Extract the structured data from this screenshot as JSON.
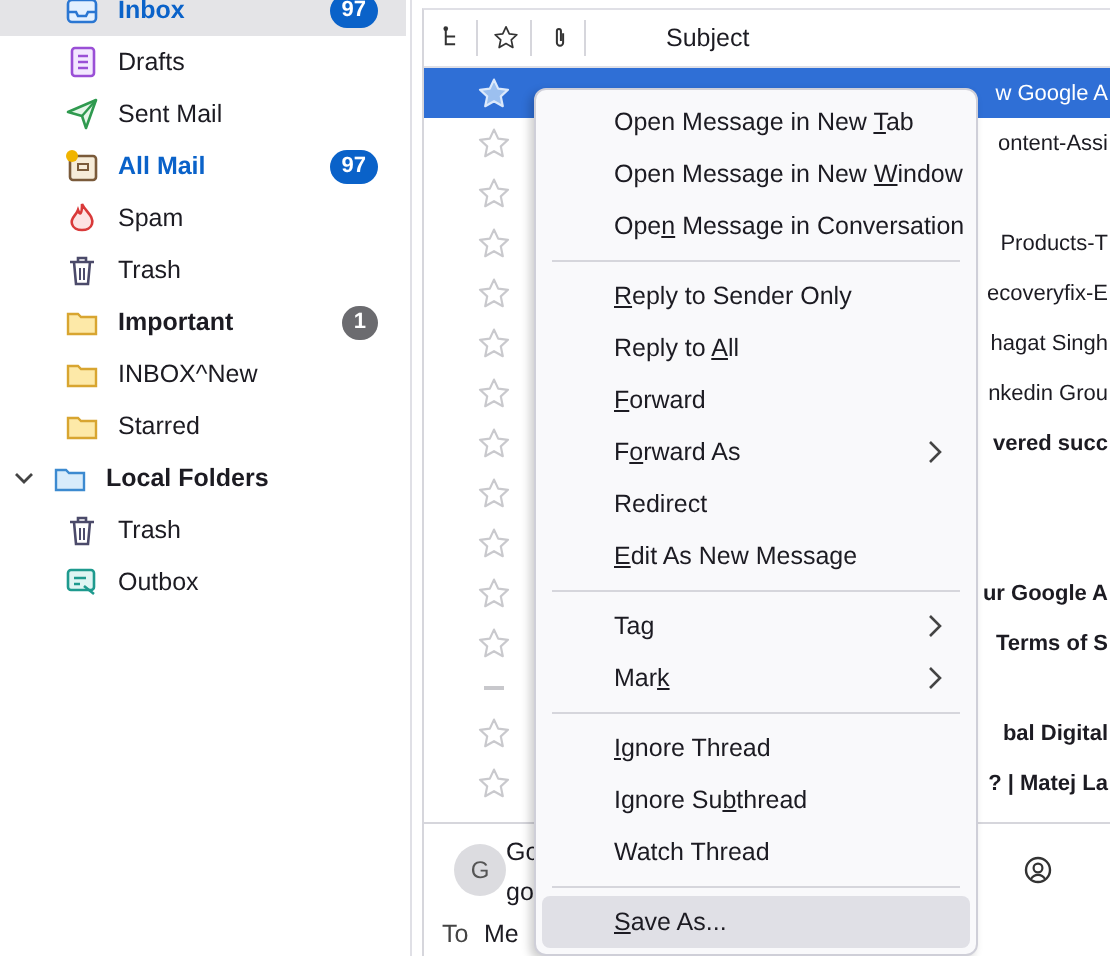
{
  "sidebar": {
    "folders": [
      {
        "kind": "inbox",
        "label": "Inbox",
        "selected": true,
        "bold": true,
        "count": "97",
        "count_highlighted": true
      },
      {
        "kind": "drafts",
        "label": "Drafts",
        "selected": false,
        "bold": false
      },
      {
        "kind": "sent",
        "label": "Sent Mail",
        "selected": false,
        "bold": false
      },
      {
        "kind": "archive",
        "label": "All Mail",
        "selected": false,
        "bold": true,
        "count": "97",
        "count_highlighted": true
      },
      {
        "kind": "spam",
        "label": "Spam",
        "selected": false,
        "bold": false
      },
      {
        "kind": "trash",
        "label": "Trash",
        "selected": false,
        "bold": false
      },
      {
        "kind": "folder",
        "label": "Important",
        "selected": false,
        "bold": true,
        "count": "1",
        "count_highlighted": false
      },
      {
        "kind": "folder",
        "label": "INBOX^New",
        "selected": false,
        "bold": false
      },
      {
        "kind": "folder",
        "label": "Starred",
        "selected": false,
        "bold": false
      },
      {
        "kind": "account",
        "label": "Local Folders",
        "selected": false,
        "bold": true,
        "expanded": true,
        "children": [
          {
            "kind": "trash",
            "label": "Trash",
            "selected": false,
            "bold": false
          },
          {
            "kind": "outbox",
            "label": "Outbox",
            "selected": false,
            "bold": false
          }
        ]
      }
    ]
  },
  "message_list": {
    "columns": [
      {
        "kind": "thread"
      },
      {
        "kind": "star"
      },
      {
        "kind": "attachment"
      },
      {
        "kind": "text",
        "label": "Subject"
      }
    ],
    "rows": [
      {
        "kind": "star",
        "subject": "w Google A",
        "selected": true,
        "bold": false
      },
      {
        "kind": "star",
        "subject": "ontent-Assi",
        "selected": false,
        "bold": false
      },
      {
        "kind": "star",
        "selected": false
      },
      {
        "kind": "star",
        "subject": "Products-T",
        "selected": false,
        "bold": false
      },
      {
        "kind": "star",
        "subject": "ecoveryfix-E",
        "selected": false,
        "bold": false
      },
      {
        "kind": "star",
        "subject": "hagat Singh",
        "selected": false,
        "bold": false
      },
      {
        "kind": "star",
        "subject": "nkedin Grou",
        "selected": false,
        "bold": false
      },
      {
        "kind": "star",
        "subject": "vered succ",
        "selected": false,
        "bold": true
      },
      {
        "kind": "star",
        "selected": false
      },
      {
        "kind": "star",
        "selected": false
      },
      {
        "kind": "star",
        "subject": "ur Google A",
        "selected": false,
        "bold": true
      },
      {
        "kind": "star",
        "subject": "Terms of S",
        "selected": false,
        "bold": true
      },
      {
        "kind": "dash",
        "selected": false
      },
      {
        "kind": "star",
        "subject": "bal Digital",
        "selected": false,
        "bold": true
      },
      {
        "kind": "star",
        "subject": "? | Matej La",
        "selected": false,
        "bold": true
      }
    ]
  },
  "message_header": {
    "avatar": "G",
    "from_start": "Go",
    "address_start": "go",
    "to_label": "To",
    "recipient": "Me"
  },
  "context_menu": {
    "items": [
      {
        "kind": "item",
        "before": "Open Message in New ",
        "key": "T",
        "after": "ab",
        "highlighted": false
      },
      {
        "kind": "item",
        "before": "Open Message in New ",
        "key": "W",
        "after": "indow",
        "highlighted": false
      },
      {
        "kind": "item",
        "before": "Ope",
        "key": "n",
        "after": " Message in Conversation",
        "highlighted": false
      },
      {
        "kind": "separator"
      },
      {
        "kind": "item",
        "key": "R",
        "after": "eply to Sender Only",
        "highlighted": false
      },
      {
        "kind": "item",
        "before": "Reply to ",
        "key": "A",
        "after": "ll",
        "highlighted": false
      },
      {
        "kind": "item",
        "key": "F",
        "after": "orward",
        "highlighted": false
      },
      {
        "kind": "item",
        "before": "F",
        "key": "o",
        "after": "rward As",
        "submenu": true,
        "highlighted": false
      },
      {
        "kind": "item",
        "before": "Redirect",
        "highlighted": false
      },
      {
        "kind": "item",
        "key": "E",
        "after": "dit As New Message",
        "highlighted": false
      },
      {
        "kind": "separator"
      },
      {
        "kind": "item",
        "before": "Tag",
        "submenu": true,
        "highlighted": false
      },
      {
        "kind": "item",
        "before": "Mar",
        "key": "k",
        "submenu": true,
        "highlighted": false
      },
      {
        "kind": "separator"
      },
      {
        "kind": "item",
        "key": "I",
        "after": "gnore Thread",
        "highlighted": false
      },
      {
        "kind": "item",
        "before": "Ignore Su",
        "key": "b",
        "after": "thread",
        "highlighted": false
      },
      {
        "kind": "item",
        "before": "Watch Thread",
        "highlighted": false
      },
      {
        "kind": "separator"
      },
      {
        "kind": "item",
        "key": "S",
        "after": "ave As...",
        "highlighted": true
      }
    ]
  }
}
